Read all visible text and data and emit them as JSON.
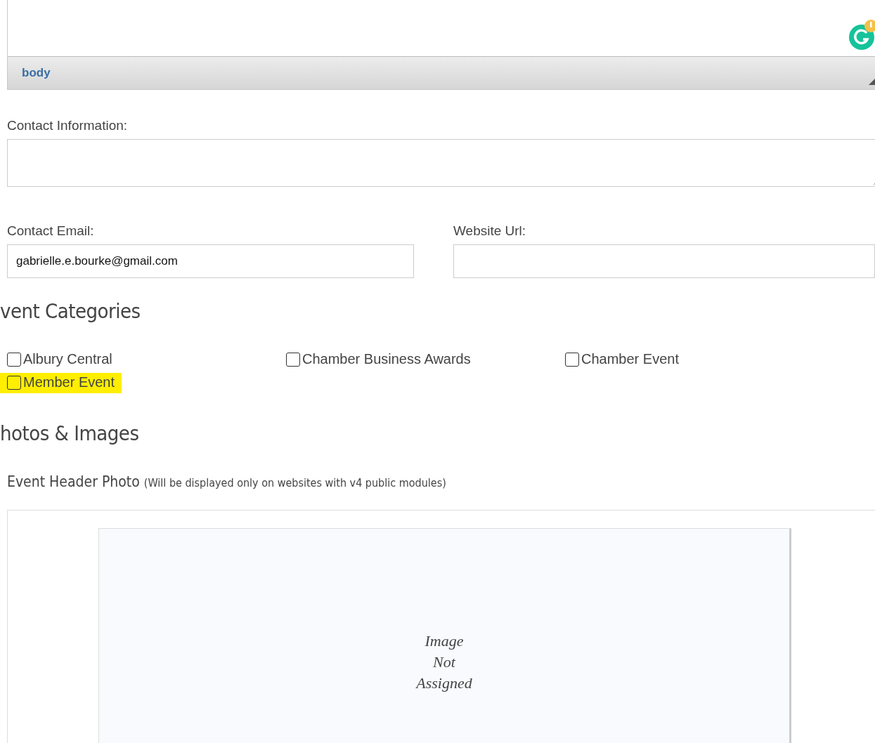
{
  "editor": {
    "status_path": "body"
  },
  "contact_information": {
    "label": "Contact Information:"
  },
  "contact_email": {
    "label": "Contact Email:",
    "value": "gabrielle.e.bourke@gmail.com"
  },
  "website_url": {
    "label": "Website Url:"
  },
  "event_categories": {
    "heading": "vent Categories",
    "items": [
      {
        "label": "Albury Central",
        "checked": false,
        "highlighted": false
      },
      {
        "label": "Chamber Business Awards",
        "checked": false,
        "highlighted": false
      },
      {
        "label": "Chamber Event",
        "checked": false,
        "highlighted": false
      },
      {
        "label": "Member Event",
        "checked": false,
        "highlighted": true
      }
    ]
  },
  "photos": {
    "heading": "hotos & Images",
    "field_label": "Event Header Photo",
    "field_note": "(Will be displayed only on websites with v4 public modules)",
    "placeholder_lines": [
      "Image",
      "Not",
      "Assigned"
    ]
  }
}
